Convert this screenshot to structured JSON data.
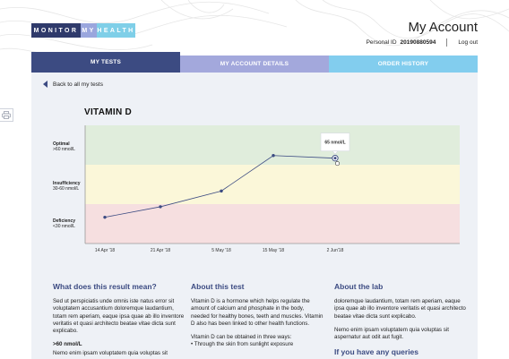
{
  "header": {
    "logo": [
      "MONITOR",
      "MY",
      "HEALTH"
    ],
    "account_title": "My Account",
    "personal_id_label": "Personal ID",
    "personal_id_value": "20190880594",
    "logout": "Log out"
  },
  "tabs": [
    {
      "label": "MY TESTS",
      "active": true
    },
    {
      "label": "MY ACCOUNT DETAILS",
      "active": false
    },
    {
      "label": "ORDER HISTORY",
      "active": false
    }
  ],
  "back_link": "Back to all my tests",
  "test_title": "VITAMIN D",
  "colors": {
    "navy": "#3c4b82",
    "lavender": "#a3a8dc",
    "sky": "#82cdee",
    "optimal_zone": "#e0eddc",
    "insufficient_zone": "#fbf7d9",
    "deficiency_zone": "#f6dfe0"
  },
  "chart_data": {
    "type": "line",
    "zones": [
      {
        "name": "Optimal",
        "range": ">60 nmol/L"
      },
      {
        "name": "Insufficiency",
        "range": "30-60 nmol/L"
      },
      {
        "name": "Deficiency",
        "range": "<30 nmol/L"
      }
    ],
    "x": [
      "14 Apr '18",
      "21 Apr '18",
      "5 May '18",
      "15 May '18",
      "2 Jun'18"
    ],
    "values": [
      20,
      28,
      40,
      67,
      65
    ],
    "ylim": [
      0,
      90
    ],
    "tooltip": "65 nmol/L",
    "grid": false
  },
  "sections": {
    "result": {
      "heading": "What does this result mean?",
      "para": "Sed ut perspiciatis unde omnis iste natus error sit voluptatem accusantium doloremque laudantium, totam rem aperiam, eaque ipsa quae ab illo inventore veritatis et quasi architecto beatae vitae dicta sunt explicabo.",
      "subhead": ">60 nmol/L",
      "para2": "Nemo enim ipsam voluptatem quia voluptas sit"
    },
    "about_test": {
      "heading": "About this test",
      "para": "Vitamin D is a hormone which helps regulate the amount of calcium and phosphate in the body, needed for healthy bones, teeth and muscles. Vitamin D also has been linked to other health functions.",
      "para2": "Vitamin D can be obtained in three ways:",
      "bullet": "• Through the skin from sunlight exposure"
    },
    "about_lab": {
      "heading": "About the lab",
      "para": "doloremque laudantium, totam rem aperiam, eaque ipsa quae ab illo inventore veritatis et quasi architecto beatae vitae dicta sunt explicabo.",
      "para2": "Nemo enim ipsam voluptatem quia voluptas sit aspernatur aut odit aut fugit.",
      "heading2": "If you have any queries"
    }
  }
}
